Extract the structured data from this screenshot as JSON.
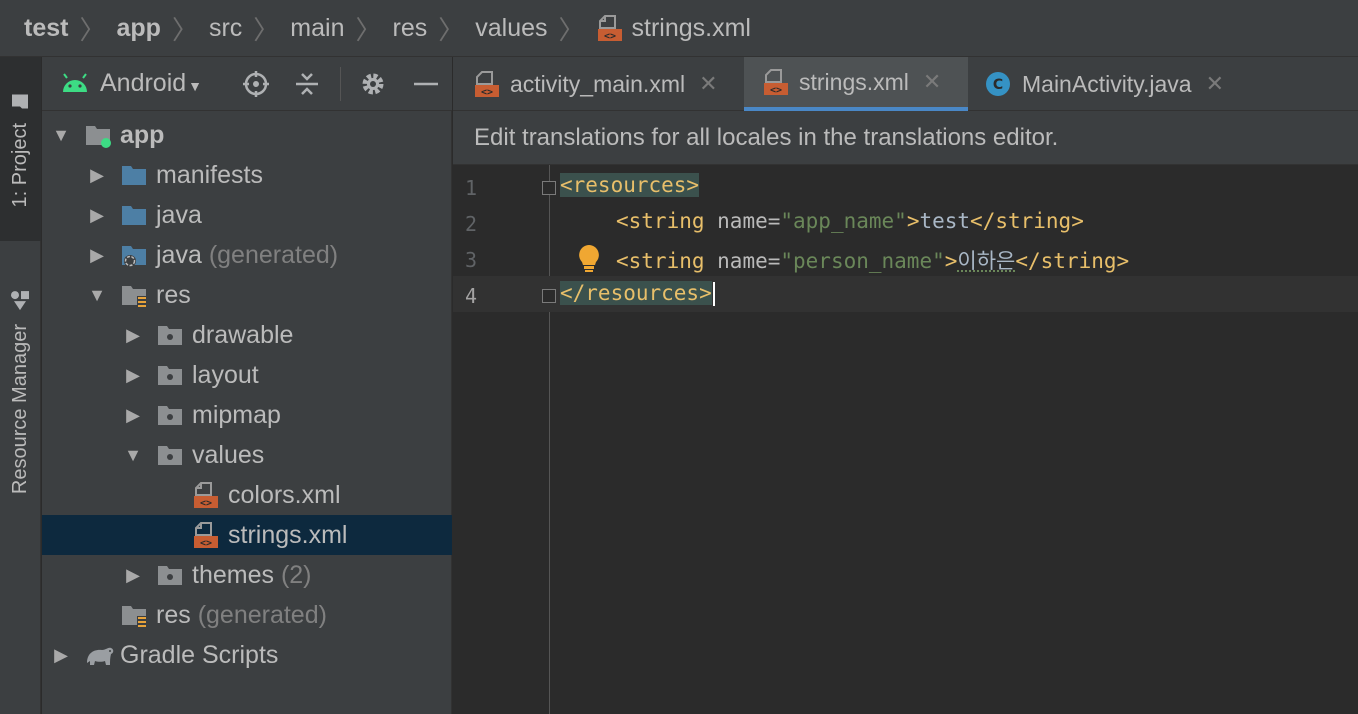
{
  "breadcrumb": {
    "items": [
      {
        "label": "test",
        "bold": true
      },
      {
        "label": "app",
        "bold": true
      },
      {
        "label": "src",
        "bold": false
      },
      {
        "label": "main",
        "bold": false
      },
      {
        "label": "res",
        "bold": false
      },
      {
        "label": "values",
        "bold": false
      },
      {
        "label": "strings.xml",
        "bold": false,
        "icon": "xml-file-icon"
      }
    ],
    "separator": "〉"
  },
  "toolstrip": {
    "project_tab": "1: Project",
    "resource_manager_tab": "Resource Manager"
  },
  "project_panel": {
    "view_selector": "Android",
    "buttons": [
      "locate-icon",
      "collapse-all-icon",
      "settings-icon",
      "hide-icon"
    ]
  },
  "tree": {
    "items": [
      {
        "label": "app",
        "sub": "",
        "bold": true,
        "expanded": true,
        "icon": "module-folder-icon"
      },
      {
        "label": "manifests",
        "sub": "",
        "expanded": false,
        "icon": "folder-icon"
      },
      {
        "label": "java",
        "sub": "",
        "expanded": false,
        "icon": "folder-icon"
      },
      {
        "label": "java",
        "sub": "(generated)",
        "expanded": false,
        "icon": "generated-folder-icon"
      },
      {
        "label": "res",
        "sub": "",
        "expanded": true,
        "icon": "res-folder-icon"
      },
      {
        "label": "drawable",
        "sub": "",
        "expanded": false,
        "icon": "package-folder-icon"
      },
      {
        "label": "layout",
        "sub": "",
        "expanded": false,
        "icon": "package-folder-icon"
      },
      {
        "label": "mipmap",
        "sub": "",
        "expanded": false,
        "icon": "package-folder-icon"
      },
      {
        "label": "values",
        "sub": "",
        "expanded": true,
        "icon": "package-folder-icon"
      },
      {
        "label": "colors.xml",
        "sub": "",
        "icon": "xml-file-icon"
      },
      {
        "label": "strings.xml",
        "sub": "",
        "icon": "xml-file-icon",
        "selected": true
      },
      {
        "label": "themes",
        "sub": "(2)",
        "expanded": false,
        "icon": "package-folder-icon"
      },
      {
        "label": "res",
        "sub": "(generated)",
        "icon": "res-folder-icon"
      },
      {
        "label": "Gradle Scripts",
        "sub": "",
        "expanded": false,
        "icon": "gradle-icon"
      }
    ]
  },
  "tabs": [
    {
      "label": "activity_main.xml",
      "icon": "xml-file-icon",
      "active": false
    },
    {
      "label": "strings.xml",
      "icon": "xml-file-icon",
      "active": true
    },
    {
      "label": "MainActivity.java",
      "icon": "java-class-icon",
      "active": false
    }
  ],
  "banner": {
    "text": "Edit translations for all locales in the translations editor."
  },
  "editor": {
    "lines": [
      {
        "num": "1",
        "tag_open": "<resources>"
      },
      {
        "num": "2",
        "indent": "    ",
        "open": "<string",
        "attr": " name=",
        "value": "\"app_name\"",
        "close": ">",
        "text": "test",
        "end": "</string>"
      },
      {
        "num": "3",
        "indent": "    ",
        "open": "<string",
        "attr": " name=",
        "value": "\"person_name\"",
        "close": ">",
        "text": "이하은",
        "end": "</string>"
      },
      {
        "num": "4",
        "tag_close": "</resources>"
      }
    ],
    "current_line": 4
  },
  "colors": {
    "tag": "#e8bf6a",
    "string_value": "#6a8759",
    "selection": "#0d293e",
    "accent": "#4a88c7"
  }
}
